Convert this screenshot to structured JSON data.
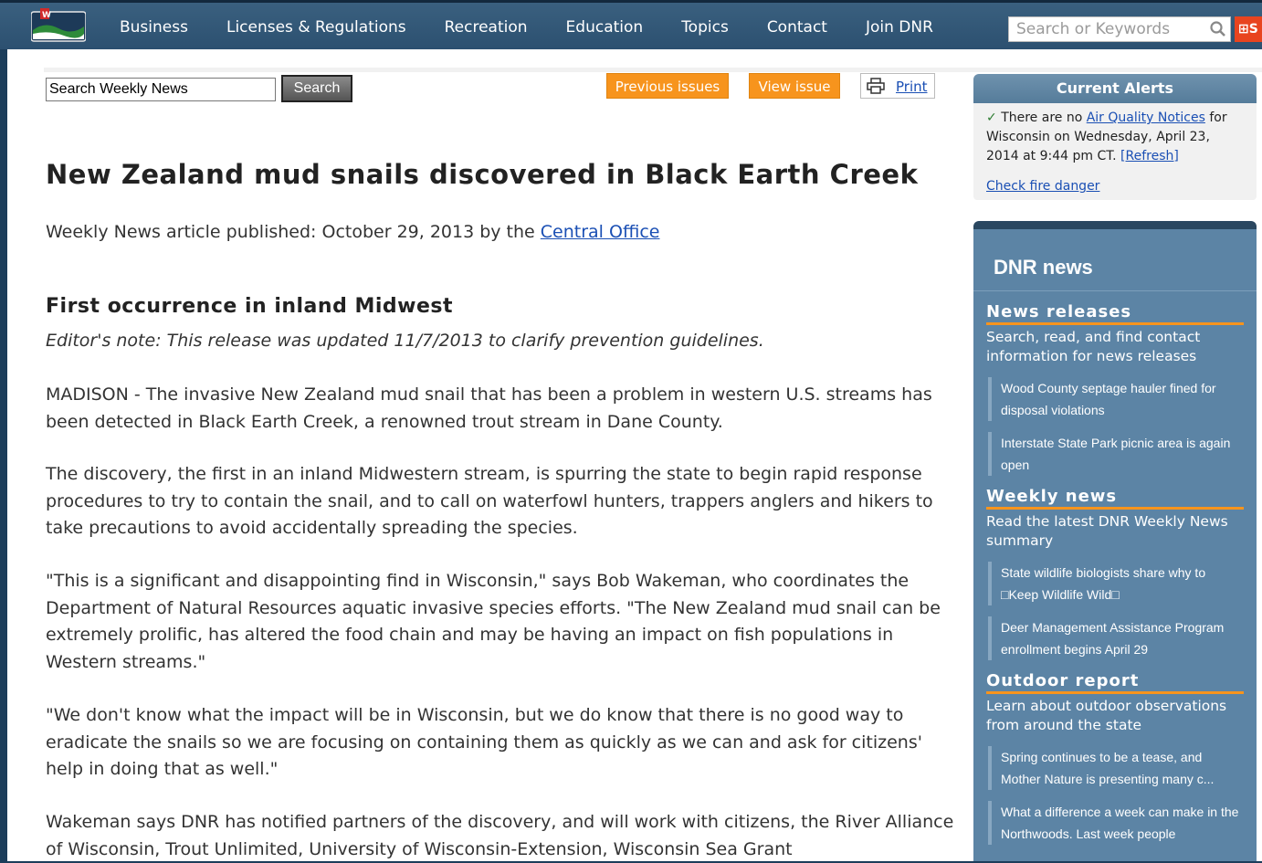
{
  "colors": {
    "nav_bg": "#2c5070",
    "accent_orange": "#f7941d",
    "panel_blue": "#5c84a5",
    "link_blue": "#1a4fb4"
  },
  "nav": {
    "logo_icon": "dnr-logo-icon",
    "items": [
      "Business",
      "Licenses & Regulations",
      "Recreation",
      "Education",
      "Topics",
      "Contact",
      "Join DNR"
    ],
    "search_placeholder": "Search or Keywords",
    "search_icon": "search-icon",
    "share_label": "S"
  },
  "toolbar": {
    "search_value": "Search Weekly News",
    "search_button": "Search",
    "previous_issues": "Previous issues",
    "view_issue": "View issue",
    "print": "Print"
  },
  "article": {
    "title": "New Zealand mud snails discovered in Black Earth Creek",
    "meta_prefix": "Weekly News article published: October 29, 2013 by the ",
    "meta_link": "Central Office",
    "subtitle": "First occurrence in inland Midwest",
    "editor_note": "Editor's note: This release was updated 11/7/2013 to clarify prevention guidelines.",
    "paragraphs": [
      "MADISON - The invasive New Zealand mud snail that has been a problem in western U.S. streams has been detected in Black Earth Creek, a renowned trout stream in Dane County.",
      "The discovery, the first in an inland Midwestern stream, is spurring the state to begin rapid response procedures to try to contain the snail, and to call on waterfowl hunters, trappers anglers and hikers to take precautions to avoid accidentally spreading the species.",
      "\"This is a significant and disappointing find in Wisconsin,\" says Bob Wakeman, who coordinates the Department of Natural Resources aquatic invasive species efforts. \"The New Zealand mud snail can be extremely prolific, has altered the food chain and may be having an impact on fish populations in Western streams.\"",
      "\"We don't know what the impact will be in Wisconsin, but we do know that there is no good way to eradicate the snails so we are focusing on containing them as quickly as we can and ask for citizens' help in doing that as well.\"",
      "Wakeman says DNR has notified partners of the discovery, and will work with citizens, the River Alliance of Wisconsin, Trout Unlimited, University of Wisconsin-Extension, Wisconsin Sea Grant"
    ]
  },
  "alerts": {
    "title": "Current Alerts",
    "text_before": "There are no ",
    "link": "Air Quality Notices",
    "text_after": " for Wisconsin on Wednesday, April 23, 2014 at 9:44 pm CT. ",
    "refresh": "[Refresh]",
    "fire_link": "Check fire danger"
  },
  "dnr_news": {
    "title": "DNR news",
    "sections": [
      {
        "title": "News releases",
        "desc": "Search, read, and find contact information for news releases",
        "items": [
          "Wood County septage hauler fined for disposal violations",
          "Interstate State Park picnic area is again open"
        ]
      },
      {
        "title": "Weekly news",
        "desc": "Read the latest DNR Weekly News summary",
        "items": [
          "State wildlife biologists share why to □Keep Wildlife Wild□",
          "Deer Management Assistance Program enrollment begins April 29"
        ]
      },
      {
        "title": "Outdoor report",
        "desc": "Learn about outdoor observations from around the state",
        "items": [
          "Spring continues to be a tease, and Mother Nature is presenting many c...",
          "What a difference a week can make in the Northwoods. Last week people"
        ]
      }
    ]
  }
}
